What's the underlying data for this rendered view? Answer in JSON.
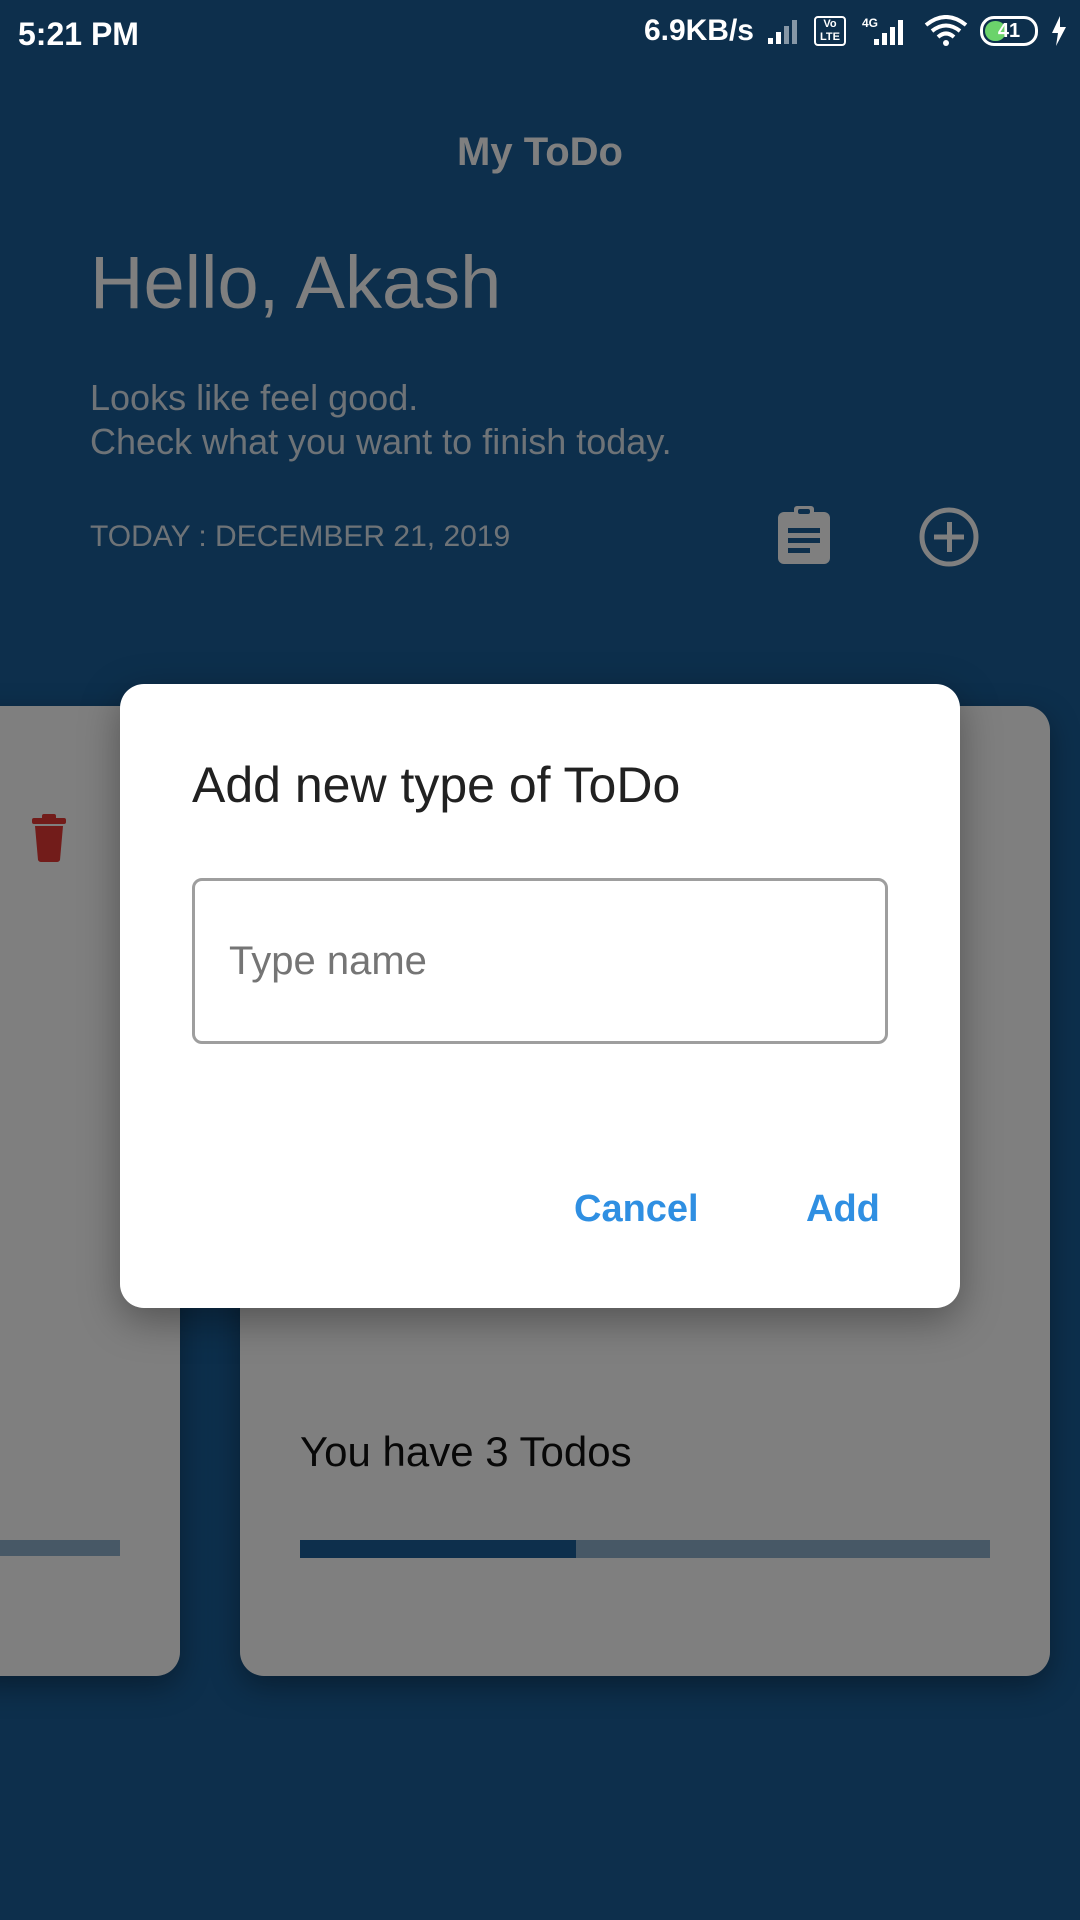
{
  "status_bar": {
    "time": "5:21 PM",
    "network_speed": "6.9KB/s",
    "volte_label": "Vo LTE",
    "network_type": "4G",
    "battery_level": "41",
    "icons": [
      "signal-icon",
      "volte-icon",
      "signal-4g-icon",
      "wifi-icon",
      "battery-icon",
      "charging-icon"
    ]
  },
  "header": {
    "app_title": "My ToDo",
    "greeting": "Hello, Akash",
    "subtitle_line1": "Looks like feel good.",
    "subtitle_line2": "Check what you want to finish today.",
    "date_label": "TODAY : DECEMBER 21, 2019",
    "icons": [
      "clipboard-icon",
      "add-circle-icon"
    ]
  },
  "cards": [
    {
      "icon": "trash-icon",
      "icon_color": "#e53935"
    },
    {
      "todo_count_text": "You have 3 Todos",
      "progress": 0.4
    }
  ],
  "dialog": {
    "title": "Add new type of ToDo",
    "input": {
      "value": "",
      "placeholder": "Type name"
    },
    "cancel_label": "Cancel",
    "add_label": "Add"
  },
  "colors": {
    "background": "#1a5e98",
    "accent": "#2f8fe2",
    "progress_track": "#8fb0cc"
  }
}
